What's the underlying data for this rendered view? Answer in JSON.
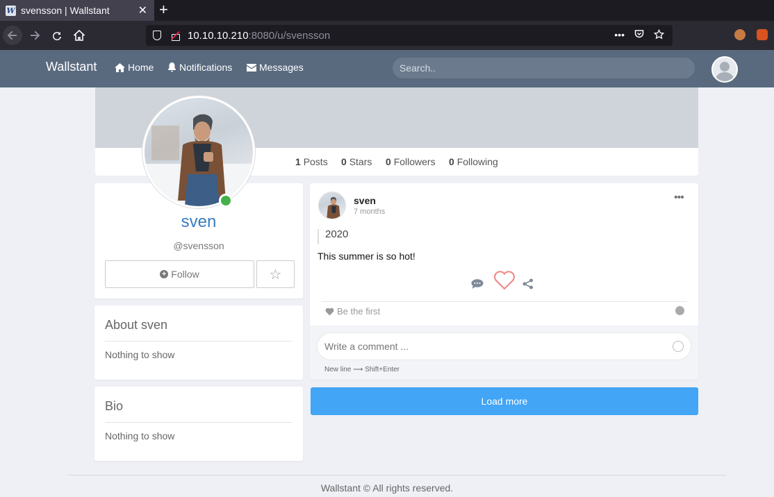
{
  "browser": {
    "tab_title": "svensson | Wallstant",
    "favicon_letter": "W",
    "new_tab_glyph": "+",
    "url_host": "10.10.10.210",
    "url_rest": ":8080/u/svensson",
    "close_glyph": "✕"
  },
  "site": {
    "brand": "Wallstant",
    "nav": {
      "home": "Home",
      "notifications": "Notifications",
      "messages": "Messages"
    },
    "search_placeholder": "Search.."
  },
  "profile": {
    "stats": {
      "posts_count": "1",
      "posts_label": "Posts",
      "stars_count": "0",
      "stars_label": "Stars",
      "followers_count": "0",
      "followers_label": "Followers",
      "following_count": "0",
      "following_label": "Following"
    },
    "name": "sven",
    "handle": "@svensson",
    "follow_label": "Follow",
    "star_glyph": "☆",
    "status": "online"
  },
  "about": {
    "title": "About sven",
    "body": "Nothing to show"
  },
  "bio": {
    "title": "Bio",
    "body": "Nothing to show"
  },
  "post": {
    "author": "sven",
    "time": "7 months",
    "menu_glyph": "•••",
    "tag": "2020",
    "text": "This summer is so hot!",
    "likes_text": "Be the first",
    "comment_placeholder": "Write a comment ...",
    "newline_hint": "New line ⟶ Shift+Enter"
  },
  "load_more": "Load more",
  "footer": "Wallstant © All rights reserved.",
  "colors": {
    "header": "#596a7f",
    "accent": "#42a5f5",
    "name": "#3a7bbf",
    "heart": "#f08a8a",
    "online": "#43b049"
  }
}
